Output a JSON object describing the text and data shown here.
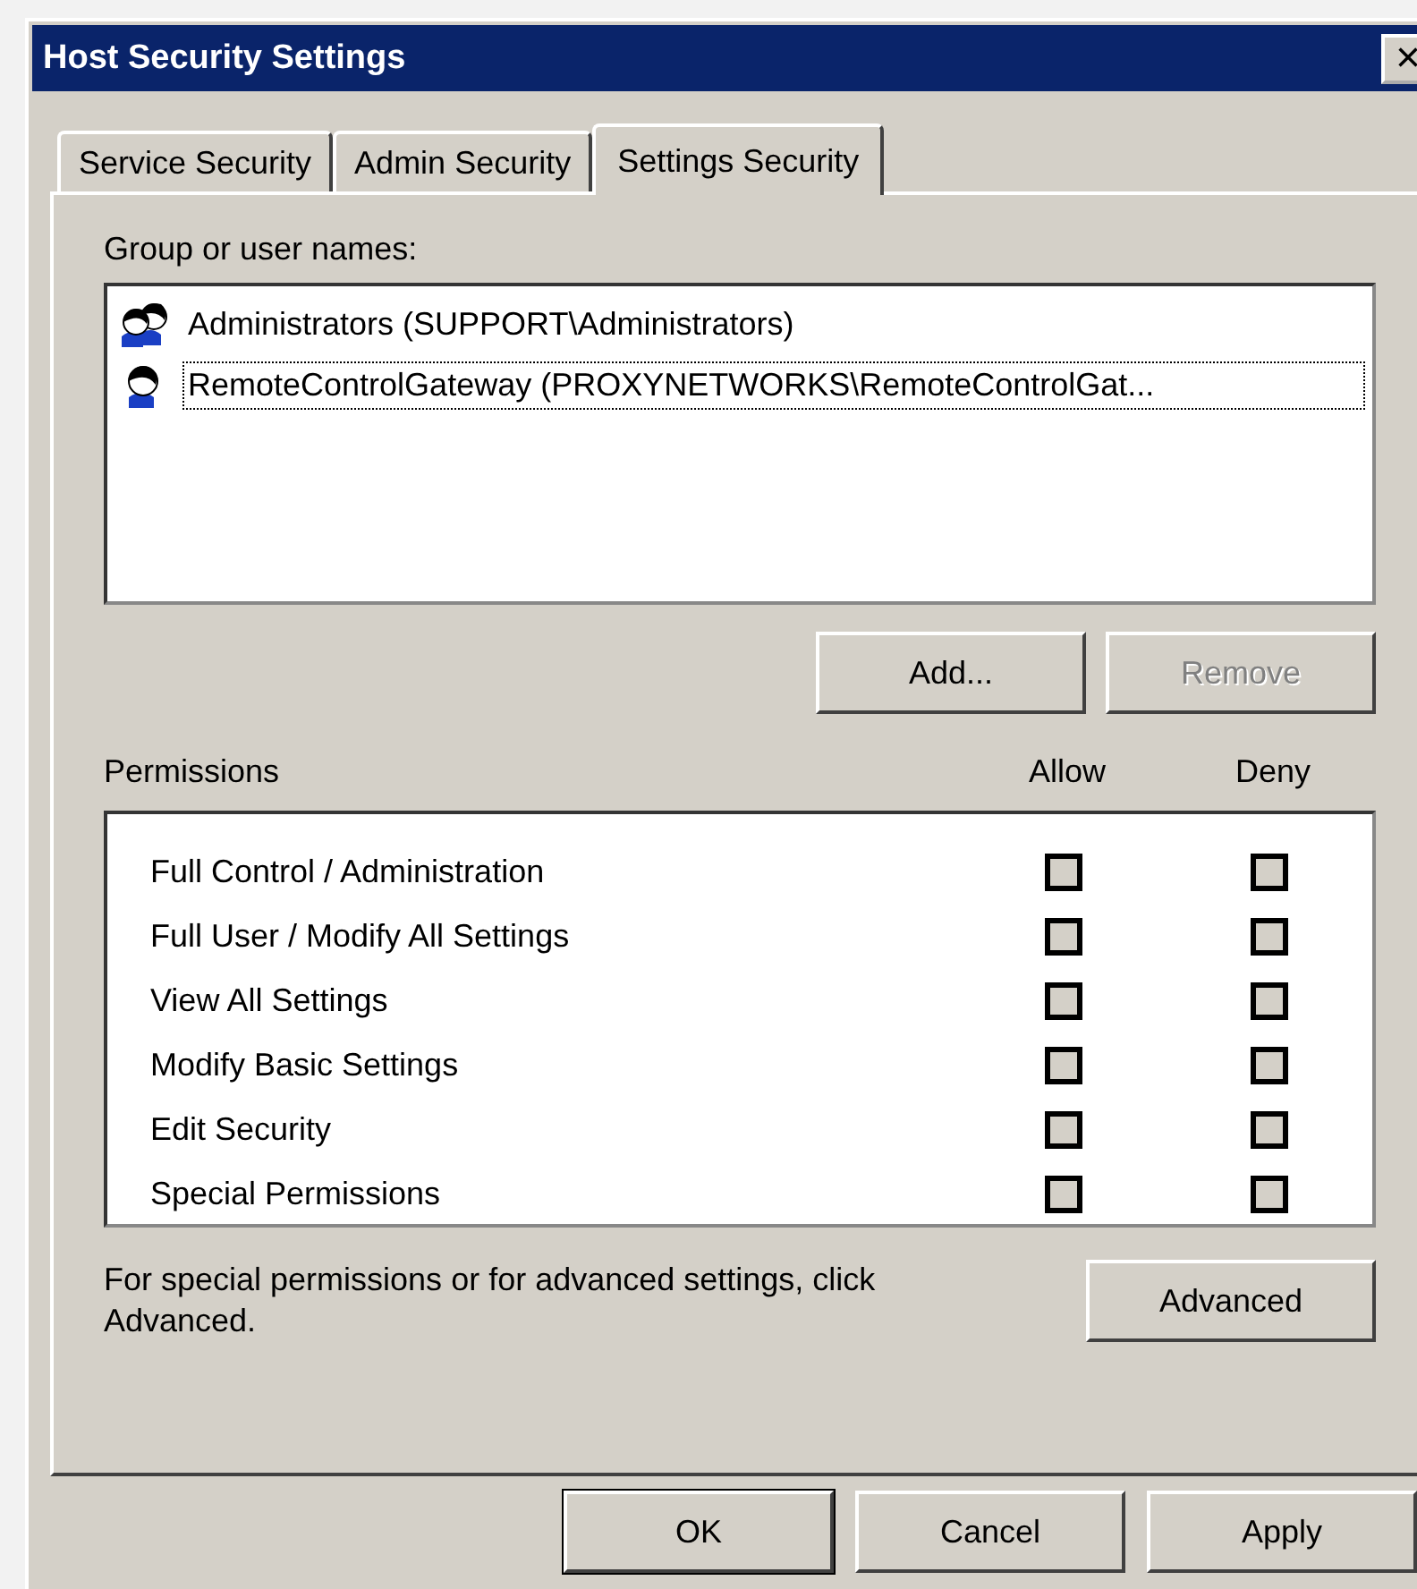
{
  "window": {
    "title": "Host Security Settings",
    "close": "×"
  },
  "tabs": [
    {
      "label": "Service Security",
      "selected": false
    },
    {
      "label": "Admin Security",
      "selected": false
    },
    {
      "label": "Settings Security",
      "selected": true
    }
  ],
  "group_label": "Group or user names:",
  "users": [
    {
      "kind": "group",
      "name": "Administrators (SUPPORT\\Administrators)",
      "selected": false
    },
    {
      "kind": "user",
      "name": "RemoteControlGateway (PROXYNETWORKS\\RemoteControlGat...",
      "selected": true
    }
  ],
  "user_buttons": [
    {
      "label": "Add...",
      "disabled": false
    },
    {
      "label": "Remove",
      "disabled": true
    }
  ],
  "permissions": {
    "header": "Permissions",
    "allow_header": "Allow",
    "deny_header": "Deny",
    "rows": [
      {
        "name": "Full Control / Administration",
        "allow": false,
        "deny": false
      },
      {
        "name": "Full User / Modify All Settings",
        "allow": false,
        "deny": false
      },
      {
        "name": "View All Settings",
        "allow": false,
        "deny": false
      },
      {
        "name": "Modify Basic Settings",
        "allow": false,
        "deny": false
      },
      {
        "name": "Edit Security",
        "allow": false,
        "deny": false
      },
      {
        "name": "Special Permissions",
        "allow": false,
        "deny": false
      }
    ]
  },
  "advanced_note": "For special permissions or for advanced settings, click Advanced.",
  "advanced_button": "Advanced",
  "buttons": [
    {
      "label": "OK",
      "default": true
    },
    {
      "label": "Cancel",
      "default": false
    },
    {
      "label": "Apply",
      "default": false
    }
  ]
}
